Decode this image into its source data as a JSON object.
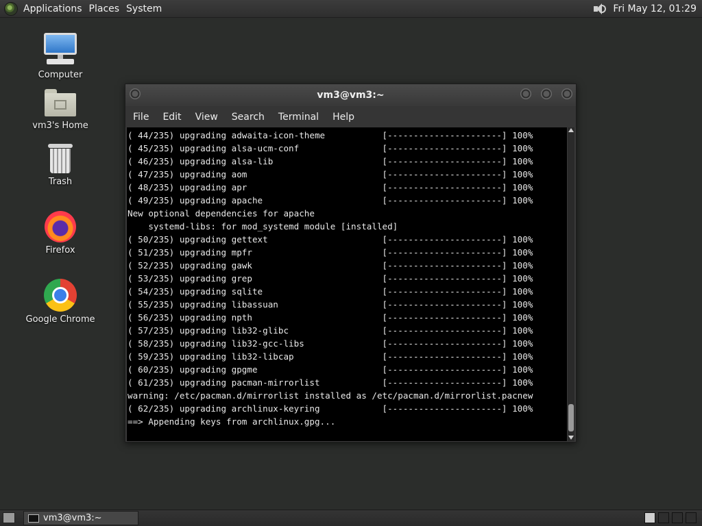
{
  "top_panel": {
    "menus": [
      "Applications",
      "Places",
      "System"
    ],
    "clock": "Fri May 12, 01:29",
    "volume_icon": "speaker-icon"
  },
  "desktop": {
    "icons": [
      {
        "label": "Computer",
        "icon": "computer-icon"
      },
      {
        "label": "vm3's Home",
        "icon": "home-folder-icon"
      },
      {
        "label": "Trash",
        "icon": "trash-icon"
      },
      {
        "label": "Firefox",
        "icon": "firefox-icon"
      },
      {
        "label": "Google Chrome",
        "icon": "chrome-icon"
      }
    ]
  },
  "terminal": {
    "title": "vm3@vm3:~",
    "menu": [
      "File",
      "Edit",
      "View",
      "Search",
      "Terminal",
      "Help"
    ],
    "lines": [
      "( 44/235) upgrading adwaita-icon-theme           [----------------------] 100%",
      "( 45/235) upgrading alsa-ucm-conf                [----------------------] 100%",
      "( 46/235) upgrading alsa-lib                     [----------------------] 100%",
      "( 47/235) upgrading aom                          [----------------------] 100%",
      "( 48/235) upgrading apr                          [----------------------] 100%",
      "( 49/235) upgrading apache                       [----------------------] 100%",
      "New optional dependencies for apache",
      "    systemd-libs: for mod_systemd module [installed]",
      "( 50/235) upgrading gettext                      [----------------------] 100%",
      "( 51/235) upgrading mpfr                         [----------------------] 100%",
      "( 52/235) upgrading gawk                         [----------------------] 100%",
      "( 53/235) upgrading grep                         [----------------------] 100%",
      "( 54/235) upgrading sqlite                       [----------------------] 100%",
      "( 55/235) upgrading libassuan                    [----------------------] 100%",
      "( 56/235) upgrading npth                         [----------------------] 100%",
      "( 57/235) upgrading lib32-glibc                  [----------------------] 100%",
      "( 58/235) upgrading lib32-gcc-libs               [----------------------] 100%",
      "( 59/235) upgrading lib32-libcap                 [----------------------] 100%",
      "( 60/235) upgrading gpgme                        [----------------------] 100%",
      "( 61/235) upgrading pacman-mirrorlist            [----------------------] 100%",
      "warning: /etc/pacman.d/mirrorlist installed as /etc/pacman.d/mirrorlist.pacnew",
      "( 62/235) upgrading archlinux-keyring            [----------------------] 100%",
      "==> Appending keys from archlinux.gpg..."
    ]
  },
  "taskbar": {
    "tasks": [
      {
        "label": "vm3@vm3:~",
        "icon": "terminal-icon"
      }
    ]
  }
}
